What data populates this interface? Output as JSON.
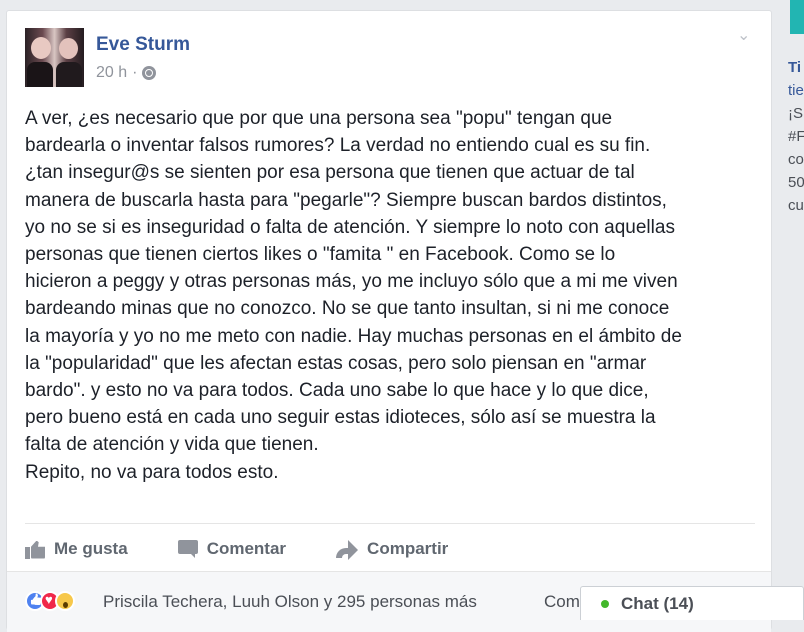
{
  "post": {
    "author": "Eve Sturm",
    "time": "20 h",
    "separator": "·",
    "privacy_icon": "globe-icon",
    "options_icon": "chevron-down-icon",
    "text": "A ver, ¿es necesario que por que una persona sea \"popu\" tengan que\nbardearla o inventar falsos rumores? La verdad no entiendo cual es su fin.\n¿tan insegur@s se sienten por esa persona que tienen que actuar de tal\nmanera de buscarla hasta para \"pegarle\"? Siempre buscan bardos distintos,\nyo no se si es inseguridad o falta de atención. Y siempre lo noto con aquellas\npersonas que tienen ciertos likes o \"famita \" en Facebook. Como se lo\nhicieron a peggy y otras personas más, yo me incluyo sólo que a mi me viven\nbardeando minas que no conozco. No se que tanto insultan, si ni me conoce\nla mayoría y yo no me meto con nadie. Hay muchas personas en el ámbito de\nla \"popularidad\" que les afectan estas cosas, pero solo piensan en \"armar\nbardo\". y esto no va para todos. Cada uno sabe lo que hace y lo que dice,\npero bueno está en cada uno seguir estas idioteces, sólo así se muestra la\nfalta de atención y vida que tienen.\nRepito, no va para todos esto."
  },
  "actions": {
    "like": "Me gusta",
    "comment": "Comentar",
    "share": "Compartir"
  },
  "reactions": {
    "icons": [
      "like-reaction-icon",
      "love-reaction-icon",
      "wow-reaction-icon"
    ],
    "summary": "Priscila Techera, Luuh Olson y 295 personas más",
    "comments_link": "Com"
  },
  "right_column": {
    "lines": [
      "Ti",
      "tie",
      "¡S",
      "#F",
      "co",
      "50",
      "cu"
    ]
  },
  "chat": {
    "label": "Chat (14)"
  },
  "colors": {
    "link": "#365899",
    "page_bg": "#e9ebee",
    "chat_online": "#42b72a",
    "accent_teal": "#22b5b2"
  }
}
